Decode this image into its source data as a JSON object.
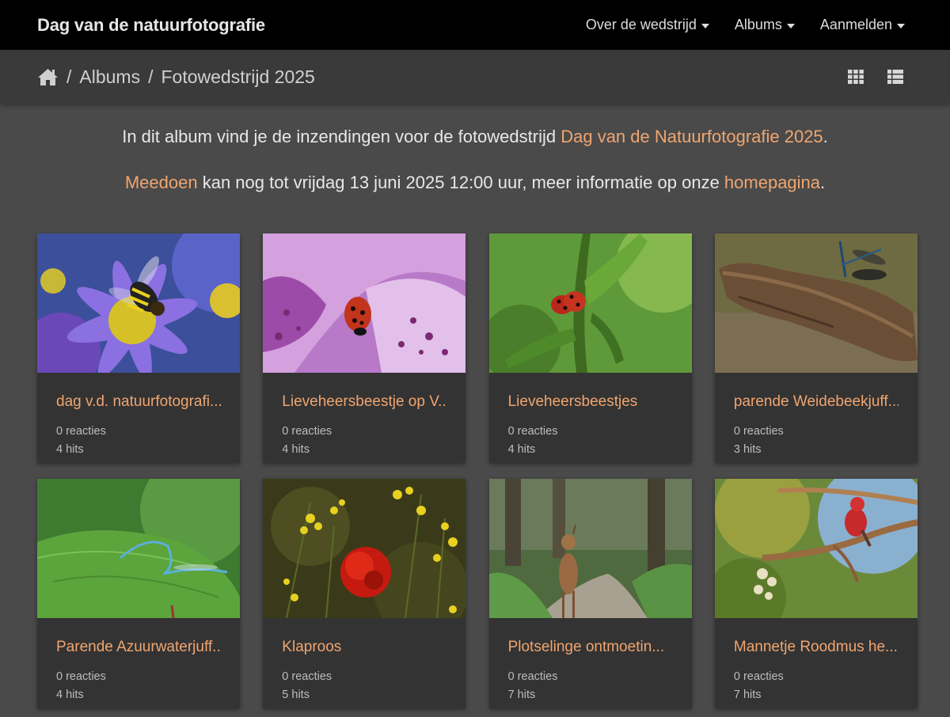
{
  "nav": {
    "brand": "Dag van de natuurfotografie",
    "links": [
      "Over de wedstrijd",
      "Albums",
      "Aanmelden"
    ]
  },
  "breadcrumb": {
    "home_icon": "home-icon",
    "items": [
      "Albums",
      "Fotowedstrijd 2025"
    ],
    "separator": "/"
  },
  "view_toggle": {
    "grid_icon": "grid-view-icon",
    "list_icon": "list-view-icon"
  },
  "intro": {
    "line1_prefix": "In dit album vind je de inzendingen voor de fotowedstrijd ",
    "line1_link": "Dag van de Natuurfotografie 2025",
    "line1_suffix": ".",
    "line2_link1": "Meedoen",
    "line2_middle": " kan nog tot vrijdag 13 juni 2025 12:00 uur, meer informatie op onze ",
    "line2_link2": "homepagina",
    "line2_suffix": "."
  },
  "colors": {
    "accent": "#f0a570",
    "navbar": "#000000",
    "background": "#4a4a4a",
    "card": "#333333"
  },
  "cards": [
    {
      "title": "dag v.d. natuurfotografi...",
      "reacties": "0 reacties",
      "hits": "4 hits"
    },
    {
      "title": "Lieveheersbeestje op V...",
      "reacties": "0 reacties",
      "hits": "4 hits"
    },
    {
      "title": "Lieveheersbeestjes",
      "reacties": "0 reacties",
      "hits": "4 hits"
    },
    {
      "title": "parende Weidebeekjuff...",
      "reacties": "0 reacties",
      "hits": "3 hits"
    },
    {
      "title": "Parende Azuurwaterjuff...",
      "reacties": "0 reacties",
      "hits": "4 hits"
    },
    {
      "title": "Klaproos",
      "reacties": "0 reacties",
      "hits": "5 hits"
    },
    {
      "title": "Plotselinge ontmoetin...",
      "reacties": "0 reacties",
      "hits": "7 hits"
    },
    {
      "title": "Mannetje Roodmus he...",
      "reacties": "0 reacties",
      "hits": "7 hits"
    }
  ]
}
